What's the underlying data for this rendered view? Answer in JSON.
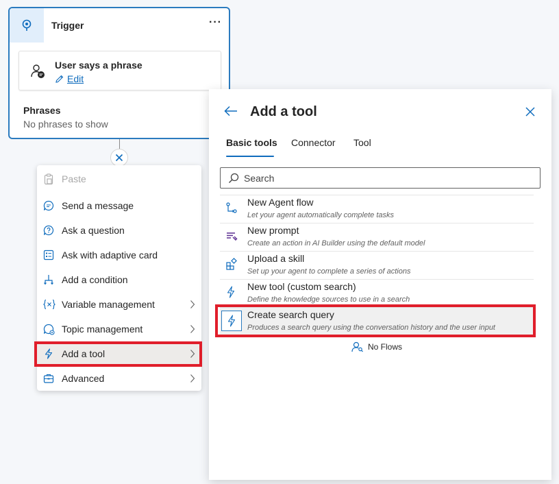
{
  "trigger": {
    "title": "Trigger",
    "more_label": "···",
    "phrase_card": {
      "title": "User says a phrase",
      "edit_label": "Edit"
    },
    "phrases_label": "Phrases",
    "phrases_empty": "No phrases to show"
  },
  "context_menu": {
    "items": [
      {
        "label": "Paste",
        "icon": "paste-icon",
        "disabled": true,
        "submenu": false
      },
      {
        "label": "Send a message",
        "icon": "chat-bubble-icon",
        "submenu": false
      },
      {
        "label": "Ask a question",
        "icon": "question-bubble-icon",
        "submenu": false
      },
      {
        "label": "Ask with adaptive card",
        "icon": "adaptive-card-icon",
        "submenu": false
      },
      {
        "label": "Add a condition",
        "icon": "branch-icon",
        "submenu": false
      },
      {
        "label": "Variable management",
        "icon": "variable-icon",
        "submenu": true
      },
      {
        "label": "Topic management",
        "icon": "topic-icon",
        "submenu": true
      },
      {
        "label": "Add a tool",
        "icon": "lightning-icon",
        "submenu": true,
        "active": true
      },
      {
        "label": "Advanced",
        "icon": "toolbox-icon",
        "submenu": true
      }
    ]
  },
  "tool_panel": {
    "title": "Add a tool",
    "tabs": [
      {
        "label": "Basic tools",
        "selected": true
      },
      {
        "label": "Connector",
        "selected": false
      },
      {
        "label": "Tool",
        "selected": false
      }
    ],
    "search": {
      "placeholder": "Search",
      "value": ""
    },
    "tools": [
      {
        "name": "New Agent flow",
        "description": "Let your agent automatically complete tasks",
        "icon": "flow-icon"
      },
      {
        "name": "New prompt",
        "description": "Create an action in AI Builder using the default model",
        "icon": "prompt-icon"
      },
      {
        "name": "Upload a skill",
        "description": "Set up your agent to complete a series of actions",
        "icon": "skill-icon"
      },
      {
        "name": "New tool (custom search)",
        "description": "Define the knowledge sources to use in a search",
        "icon": "lightning-icon"
      },
      {
        "name": "Create search query",
        "description": "Produces a search query using the conversation history and the user input",
        "icon": "lightning-icon",
        "active": true
      }
    ],
    "no_flows_label": "No Flows"
  },
  "colors": {
    "accent": "#0f6cbd",
    "highlight": "#e01e2b",
    "trigger_border": "#2b7bbf"
  }
}
